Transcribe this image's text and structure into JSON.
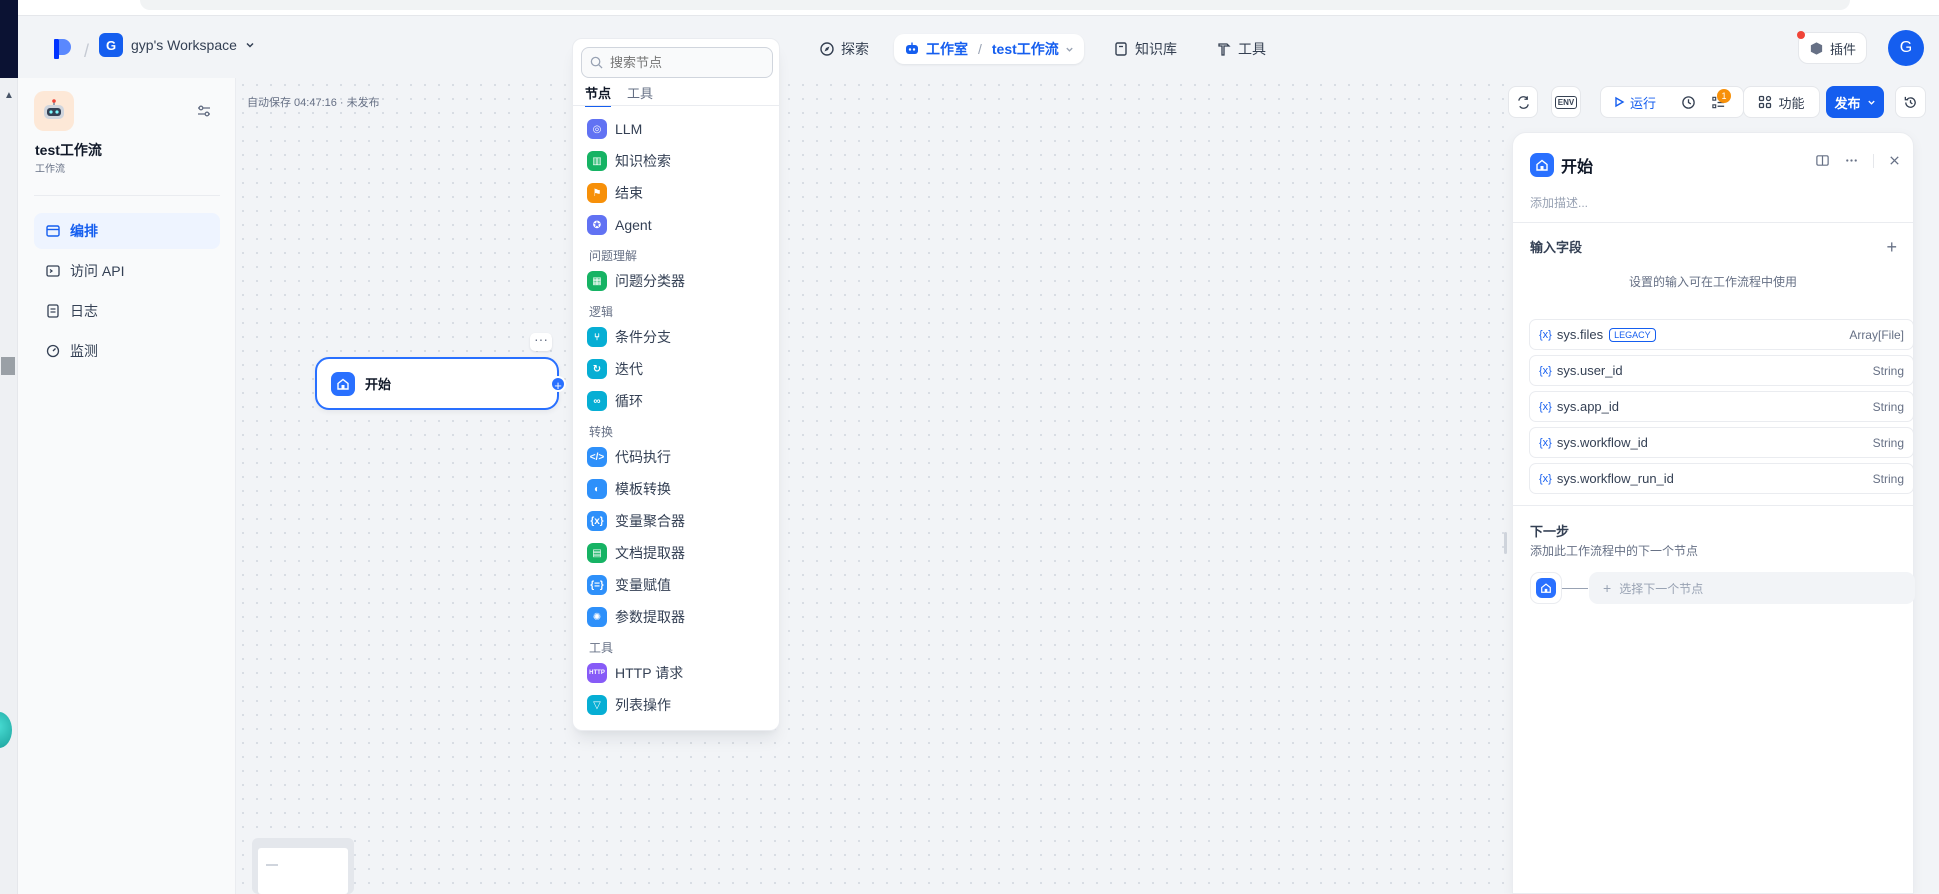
{
  "header": {
    "workspace_badge": "G",
    "workspace_name": "gyp's Workspace",
    "nav": {
      "explore": "探索",
      "studio": "工作室",
      "current_app": "test工作流",
      "knowledge": "知识库",
      "tools": "工具"
    },
    "plugin": "插件",
    "avatar": "G"
  },
  "sidebar": {
    "app_name": "test工作流",
    "app_type": "工作流",
    "items": [
      {
        "label": "编排",
        "icon": "layout-icon",
        "active": true
      },
      {
        "label": "访问 API",
        "icon": "terminal-icon",
        "active": false
      },
      {
        "label": "日志",
        "icon": "file-list-icon",
        "active": false
      },
      {
        "label": "监测",
        "icon": "gauge-icon",
        "active": false
      }
    ]
  },
  "canvas": {
    "autosave": "自动保存 04:47:16 · 未发布",
    "start_node": "开始",
    "more": "···"
  },
  "selector": {
    "search_placeholder": "搜索节点",
    "tabs": [
      "节点",
      "工具"
    ],
    "items": [
      {
        "label": "LLM",
        "icon": "llm-icon",
        "color": "#6172f3"
      },
      {
        "label": "知识检索",
        "icon": "book-icon",
        "color": "#16b364"
      },
      {
        "label": "结束",
        "icon": "flag-icon",
        "color": "#f79009"
      },
      {
        "label": "Agent",
        "icon": "agent-icon",
        "color": "#6172f3"
      },
      {
        "category": "问题理解"
      },
      {
        "label": "问题分类器",
        "icon": "classifier-icon",
        "color": "#16b364"
      },
      {
        "category": "逻辑"
      },
      {
        "label": "条件分支",
        "icon": "branch-icon",
        "color": "#06aed4"
      },
      {
        "label": "迭代",
        "icon": "iteration-icon",
        "color": "#06aed4"
      },
      {
        "label": "循环",
        "icon": "loop-icon",
        "color": "#06aed4"
      },
      {
        "category": "转换"
      },
      {
        "label": "代码执行",
        "icon": "code-icon",
        "color": "#2e90fa"
      },
      {
        "label": "模板转换",
        "icon": "template-icon",
        "color": "#2e90fa"
      },
      {
        "label": "变量聚合器",
        "icon": "variable-icon",
        "color": "#2e90fa"
      },
      {
        "label": "文档提取器",
        "icon": "document-icon",
        "color": "#16b364"
      },
      {
        "label": "变量赋值",
        "icon": "assign-icon",
        "color": "#2e90fa"
      },
      {
        "label": "参数提取器",
        "icon": "param-icon",
        "color": "#2e90fa"
      },
      {
        "category": "工具"
      },
      {
        "label": "HTTP 请求",
        "icon": "http-icon",
        "color": "#875bf7",
        "glyph": "HTTP"
      },
      {
        "label": "列表操作",
        "icon": "filter-icon",
        "color": "#06aed4"
      }
    ]
  },
  "toolbar": {
    "run": "运行",
    "feature": "功能",
    "publish": "发布",
    "checklist_count": "1",
    "env": "ENV"
  },
  "panel": {
    "title": "开始",
    "desc_placeholder": "添加描述...",
    "input_fields": "输入字段",
    "hint": "设置的输入可在工作流程中使用",
    "vars": [
      {
        "name": "sys.files",
        "type": "Array[File]",
        "badge": "LEGACY"
      },
      {
        "name": "sys.user_id",
        "type": "String"
      },
      {
        "name": "sys.app_id",
        "type": "String"
      },
      {
        "name": "sys.workflow_id",
        "type": "String"
      },
      {
        "name": "sys.workflow_run_id",
        "type": "String"
      }
    ],
    "next_title": "下一步",
    "next_sub": "添加此工作流程中的下一个节点",
    "next_select": "选择下一个节点"
  }
}
